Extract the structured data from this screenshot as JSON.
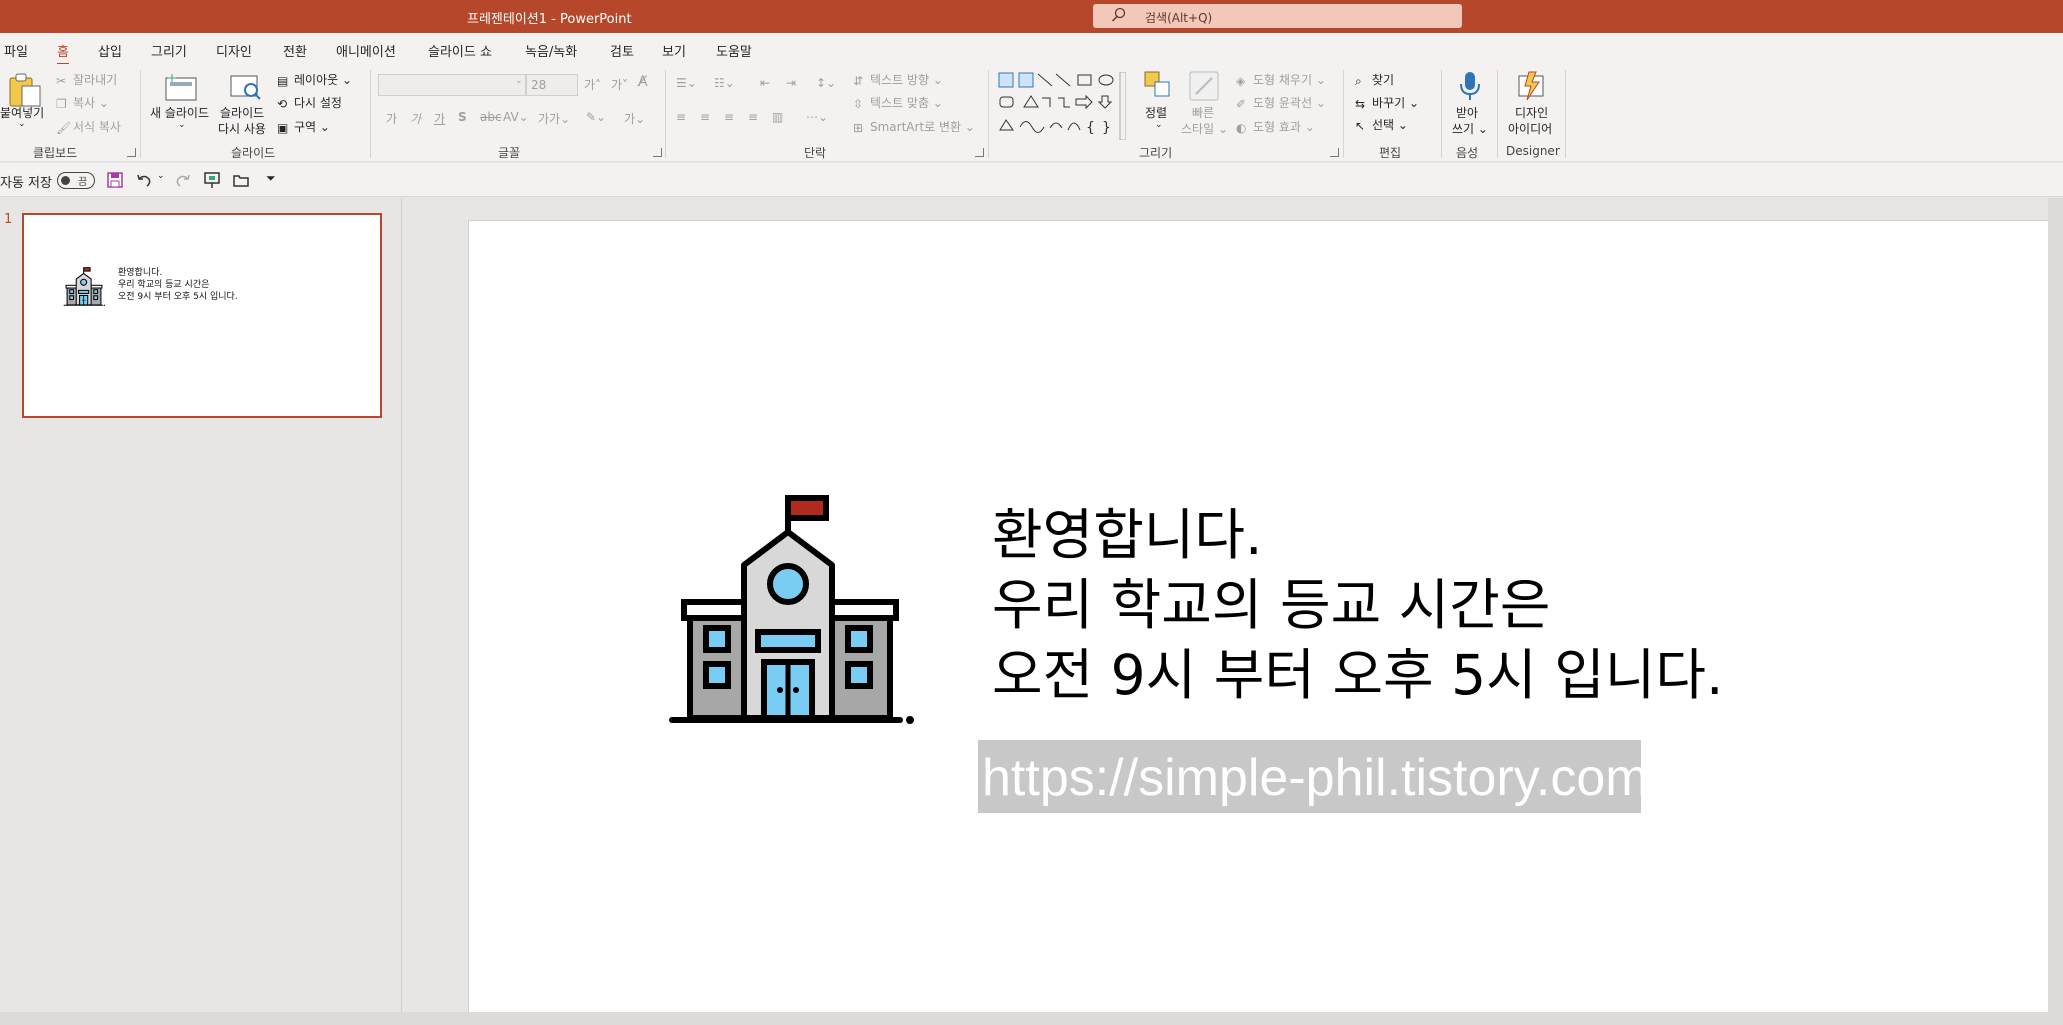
{
  "titlebar": {
    "title": "프레젠테이션1  -  PowerPoint",
    "search_placeholder": "검색(Alt+Q)"
  },
  "tabs": [
    "파일",
    "홈",
    "삽입",
    "그리기",
    "디자인",
    "전환",
    "애니메이션",
    "슬라이드 쇼",
    "녹음/녹화",
    "검토",
    "보기",
    "도움말"
  ],
  "ribbon": {
    "clipboard": {
      "paste": "붙여넣기",
      "cut": "잘라내기",
      "copy": "복사",
      "format_painter": "서식 복사",
      "label": "클립보드"
    },
    "slides": {
      "new_slide_1": "새 슬라이드",
      "reuse_1": "슬라이드",
      "reuse_2": "다시 사용",
      "layout": "레이아웃",
      "reset": "다시 설정",
      "section": "구역",
      "label": "슬라이드"
    },
    "font": {
      "size": "28",
      "label": "글꼴"
    },
    "paragraph": {
      "text_direction": "텍스트 방향",
      "align_text": "텍스트 맞춤",
      "smartart": "SmartArt로 변환",
      "label": "단락"
    },
    "drawing": {
      "arrange": "정렬",
      "quick_styles_1": "빠른",
      "quick_styles_2": "스타일",
      "fill": "도형 채우기",
      "outline": "도형 윤곽선",
      "effects": "도형 효과",
      "label": "그리기"
    },
    "editing": {
      "find": "찾기",
      "replace": "바꾸기",
      "select": "선택",
      "label": "편집"
    },
    "voice": {
      "dictate_1": "받아",
      "dictate_2": "쓰기",
      "label": "음성"
    },
    "designer": {
      "ideas_1": "디자인",
      "ideas_2": "아이디어",
      "label": "Designer"
    }
  },
  "qat": {
    "autosave": "자동 저장",
    "autosave_state": "끔"
  },
  "thumbnail": {
    "number": "1",
    "line1": "환영합니다.",
    "line2": "우리 학교의 등교 시간은",
    "line3": "오전 9시 부터 오후 5시 입니다."
  },
  "slide": {
    "line1": "환영합니다.",
    "line2": "우리 학교의 등교 시간은",
    "line3": "오전 9시 부터 오후 5시 입니다.",
    "url": "https://simple-phil.tistory.com"
  },
  "colors": {
    "accent": "#b7472a",
    "ribbon_bg": "#f3f2f1",
    "url_box": "#c8c8c8",
    "school_blue": "#79cdf2"
  }
}
